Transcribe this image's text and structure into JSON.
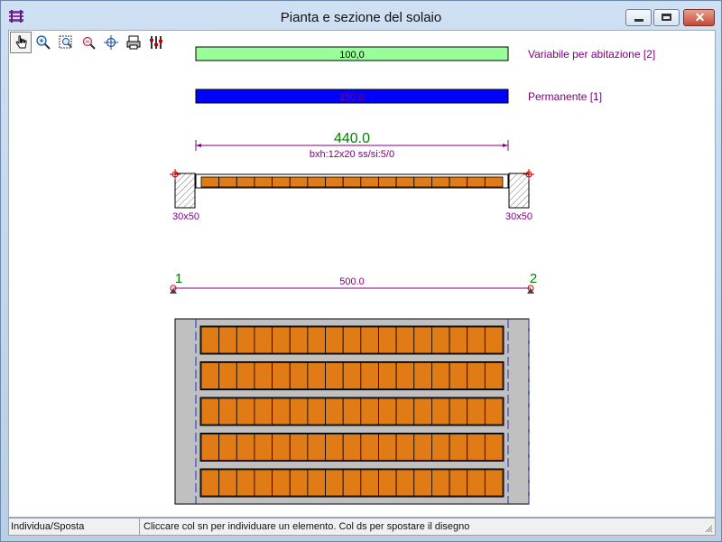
{
  "window": {
    "title": "Pianta e sezione del solaio"
  },
  "toolbar": {
    "tools": [
      {
        "icon": "hand-pointer-icon",
        "active": true
      },
      {
        "icon": "zoom-in-icon",
        "active": false
      },
      {
        "icon": "zoom-window-icon",
        "active": false
      },
      {
        "icon": "zoom-extents-icon",
        "active": false
      },
      {
        "icon": "pan-crosshair-icon",
        "active": false
      },
      {
        "icon": "print-icon",
        "active": false
      },
      {
        "icon": "settings-bars-icon",
        "active": false
      }
    ]
  },
  "loads": {
    "variable": {
      "value": "100,0",
      "label": "Variabile per abitazione [2]",
      "color": "#99ff99"
    },
    "permanent": {
      "value": "250,0",
      "label": "Permanente [1]",
      "color": "#0000ff"
    }
  },
  "section": {
    "span": "440.0",
    "properties": "bxh:12x20  ss/si:5/0",
    "support_left": "30x50",
    "support_right": "30x50",
    "block_count": 17
  },
  "axes": {
    "node_left": "1",
    "node_right": "2",
    "distance": "500.0"
  },
  "plan": {
    "rows": 5,
    "blocks_per_row": 17
  },
  "colors": {
    "dimension": "#800080",
    "node": "#008000",
    "brick": "#e07b16",
    "plan_gray": "#c0c0c0"
  },
  "status": {
    "mode": "Individua/Sposta",
    "hint": "Cliccare col sn per individuare un elemento. Col ds per spostare il disegno"
  }
}
